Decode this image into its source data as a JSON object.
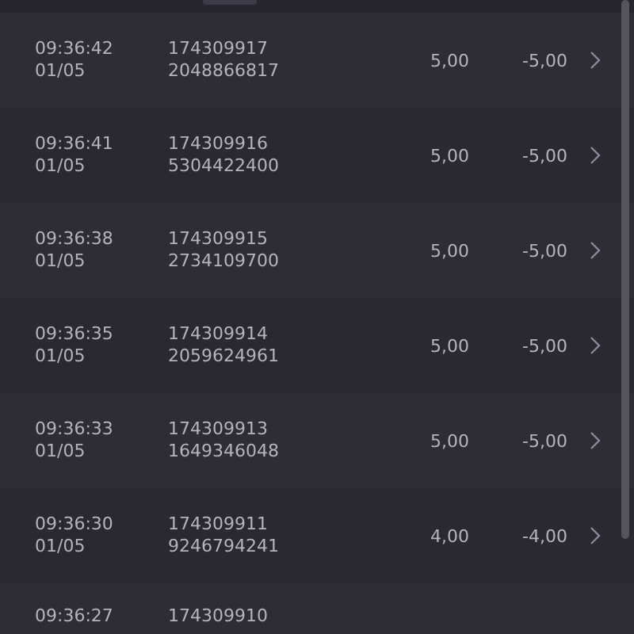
{
  "rows": [
    {
      "time": "09:36:42",
      "date": "01/05",
      "id": "174309917",
      "ref": "2048866817",
      "amount": "5,00",
      "change": "-5,00"
    },
    {
      "time": "09:36:41",
      "date": "01/05",
      "id": "174309916",
      "ref": "5304422400",
      "amount": "5,00",
      "change": "-5,00"
    },
    {
      "time": "09:36:38",
      "date": "01/05",
      "id": "174309915",
      "ref": "2734109700",
      "amount": "5,00",
      "change": "-5,00"
    },
    {
      "time": "09:36:35",
      "date": "01/05",
      "id": "174309914",
      "ref": "2059624961",
      "amount": "5,00",
      "change": "-5,00"
    },
    {
      "time": "09:36:33",
      "date": "01/05",
      "id": "174309913",
      "ref": "1649346048",
      "amount": "5,00",
      "change": "-5,00"
    },
    {
      "time": "09:36:30",
      "date": "01/05",
      "id": "174309911",
      "ref": "9246794241",
      "amount": "4,00",
      "change": "-4,00"
    },
    {
      "time": "09:36:27",
      "id": "174309910"
    }
  ]
}
